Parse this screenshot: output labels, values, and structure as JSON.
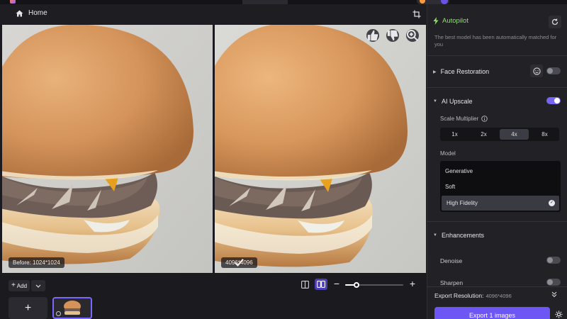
{
  "subheader": {
    "home_label": "Home"
  },
  "images": {
    "before_label": "Before: 1024*1024",
    "after_label": "4096*4096"
  },
  "bottombar": {
    "add_label": "Add",
    "zoom_level": 0.2
  },
  "panel": {
    "autopilot_title": "Autopilot",
    "autopilot_desc": "The best model has been automatically matched for you",
    "face_restoration": {
      "label": "Face Restoration",
      "enabled": false
    },
    "ai_upscale": {
      "label": "AI Upscale",
      "enabled": true
    },
    "scale_multiplier": {
      "label": "Scale Multiplier",
      "options": [
        "1x",
        "2x",
        "4x",
        "8x"
      ],
      "selected": "4x"
    },
    "model": {
      "label": "Model",
      "options": [
        "Generative",
        "Soft",
        "High Fidelity"
      ],
      "selected": "High Fidelity"
    },
    "enhancements": {
      "label": "Enhancements",
      "denoise": {
        "label": "Denoise",
        "enabled": false
      },
      "sharpen": {
        "label": "Sharpen",
        "enabled": false
      }
    },
    "export_resolution_label": "Export Resolution:",
    "export_resolution_value": "4096*4096",
    "export_button": "Export 1 images"
  },
  "colors": {
    "accent": "#6c57f5",
    "autopilot_green": "#8ee06b",
    "panel_bg": "#222226",
    "app_bg": "#1b1b1f"
  }
}
